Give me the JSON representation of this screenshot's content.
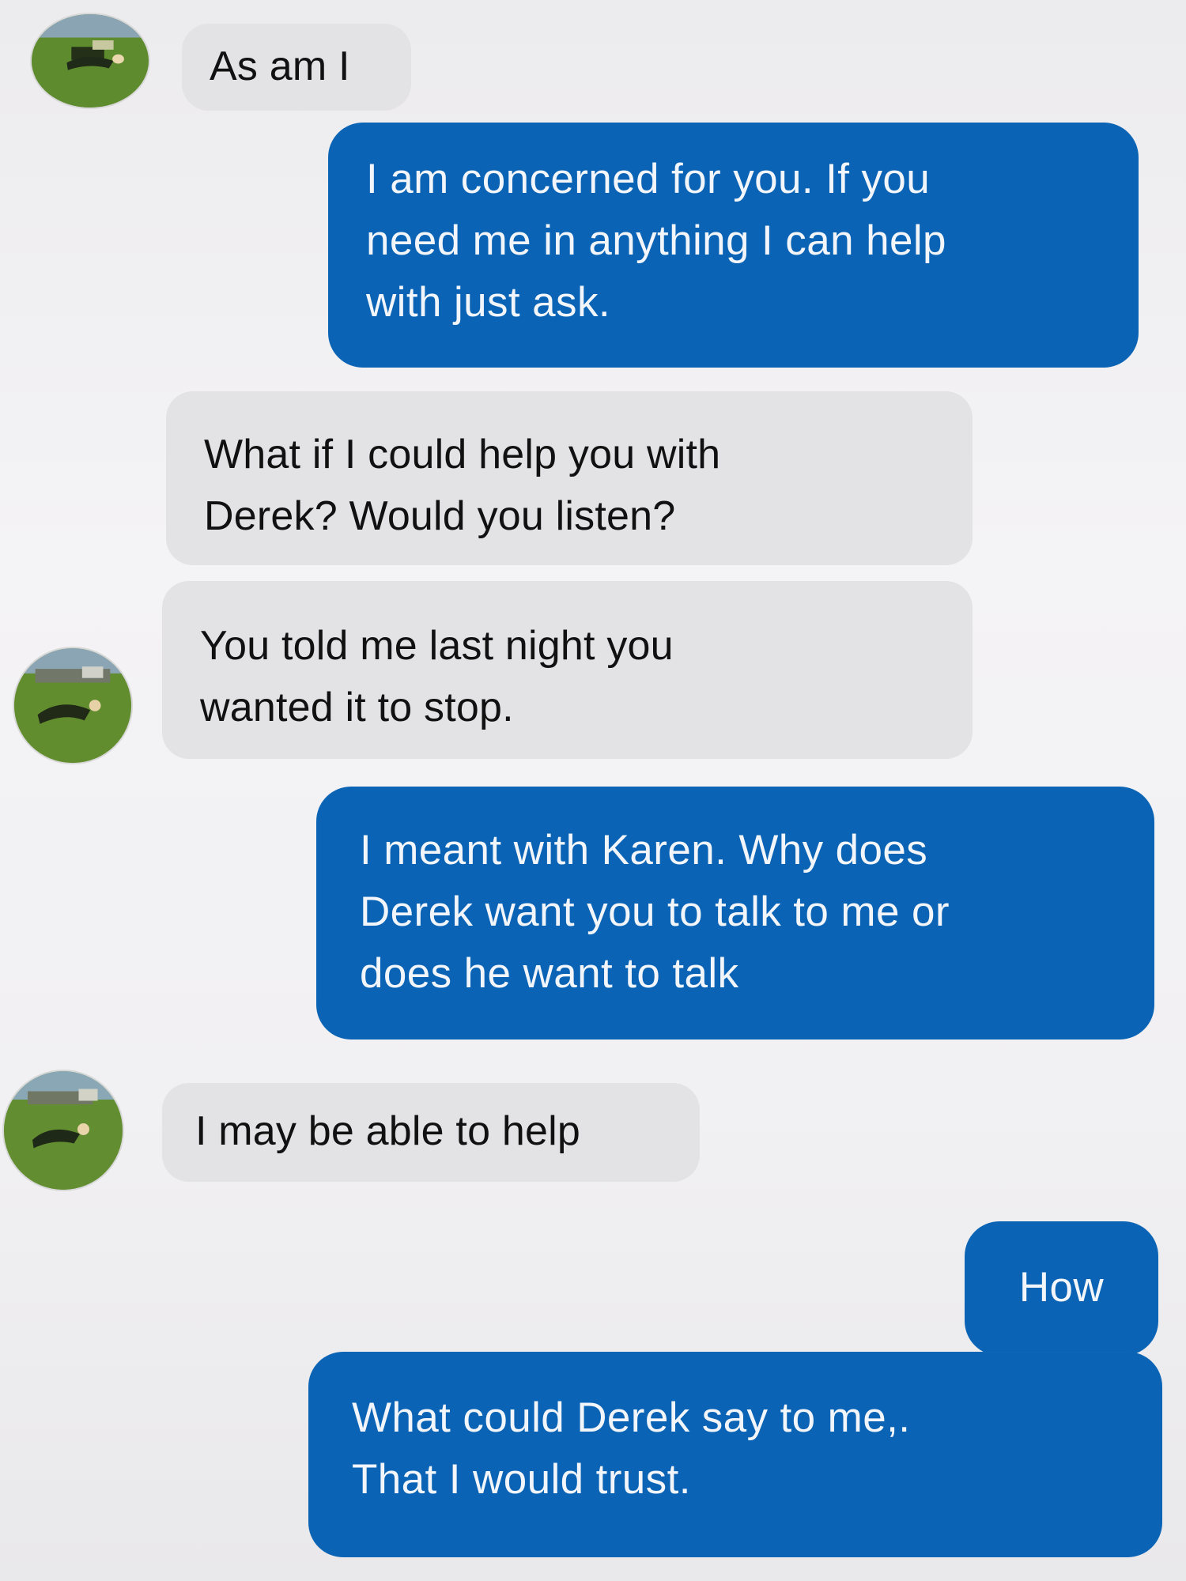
{
  "conversation": {
    "messages": [
      {
        "direction": "incoming",
        "text": "As am I",
        "avatar": "profile-photo"
      },
      {
        "direction": "outgoing",
        "text": "I am concerned for you.     If you\nneed me in anything I can help\nwith just ask."
      },
      {
        "direction": "incoming",
        "text": "What if I could help you with\nDerek? Would you listen?"
      },
      {
        "direction": "incoming",
        "text": "You told me last night you\nwanted it to stop.",
        "avatar": "profile-photo"
      },
      {
        "direction": "outgoing",
        "text": "I meant with Karen.   Why does\nDerek want you to talk to me or\ndoes he want to talk"
      },
      {
        "direction": "incoming",
        "text": "I may be able to help",
        "avatar": "profile-photo"
      },
      {
        "direction": "outgoing",
        "text": "How"
      },
      {
        "direction": "outgoing",
        "text": "What could Derek say to me,.\nThat I would trust."
      }
    ]
  },
  "colors": {
    "outgoing_bubble": "#0a63b4",
    "incoming_bubble": "#e3e2e5",
    "outgoing_text": "#f2f6fb",
    "incoming_text": "#111111"
  }
}
